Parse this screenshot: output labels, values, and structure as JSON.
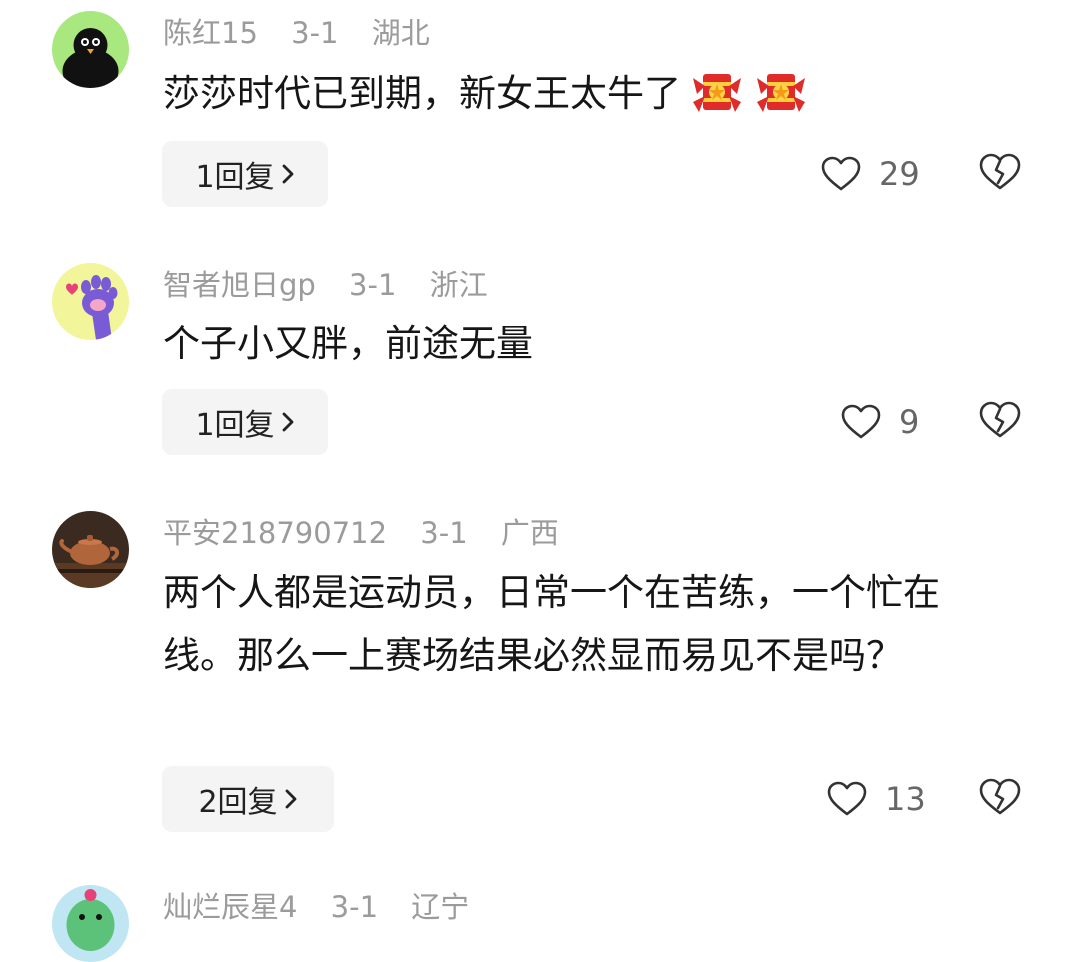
{
  "comments": [
    {
      "username": "陈红15",
      "date": "3-1",
      "location": "湖北",
      "text": "莎莎时代已到期，新女王太牛了",
      "emoji": "firecracker-icon",
      "reply_label": "1回复",
      "likes": "29",
      "avatar": "black-bird-avatar"
    },
    {
      "username": "智者旭日gp",
      "date": "3-1",
      "location": "浙江",
      "text": "个子小又胖，前途无量",
      "reply_label": "1回复",
      "likes": "9",
      "avatar": "purple-paw-avatar"
    },
    {
      "username": "平安218790712",
      "date": "3-1",
      "location": "广西",
      "text": "两个人都是运动员，日常一个在苦练，一个忙在线。那么一上赛场结果必然显而易见不是吗？",
      "reply_label": "2回复",
      "likes": "13",
      "avatar": "teapot-avatar"
    },
    {
      "username": "灿烂辰星4",
      "date": "3-1",
      "location": "辽宁",
      "avatar": "green-cartoon-avatar"
    }
  ],
  "colors": {
    "meta_text": "#9b9b9b",
    "body_text": "#161616",
    "reply_bg": "#f4f4f4",
    "icon": "#333333"
  }
}
